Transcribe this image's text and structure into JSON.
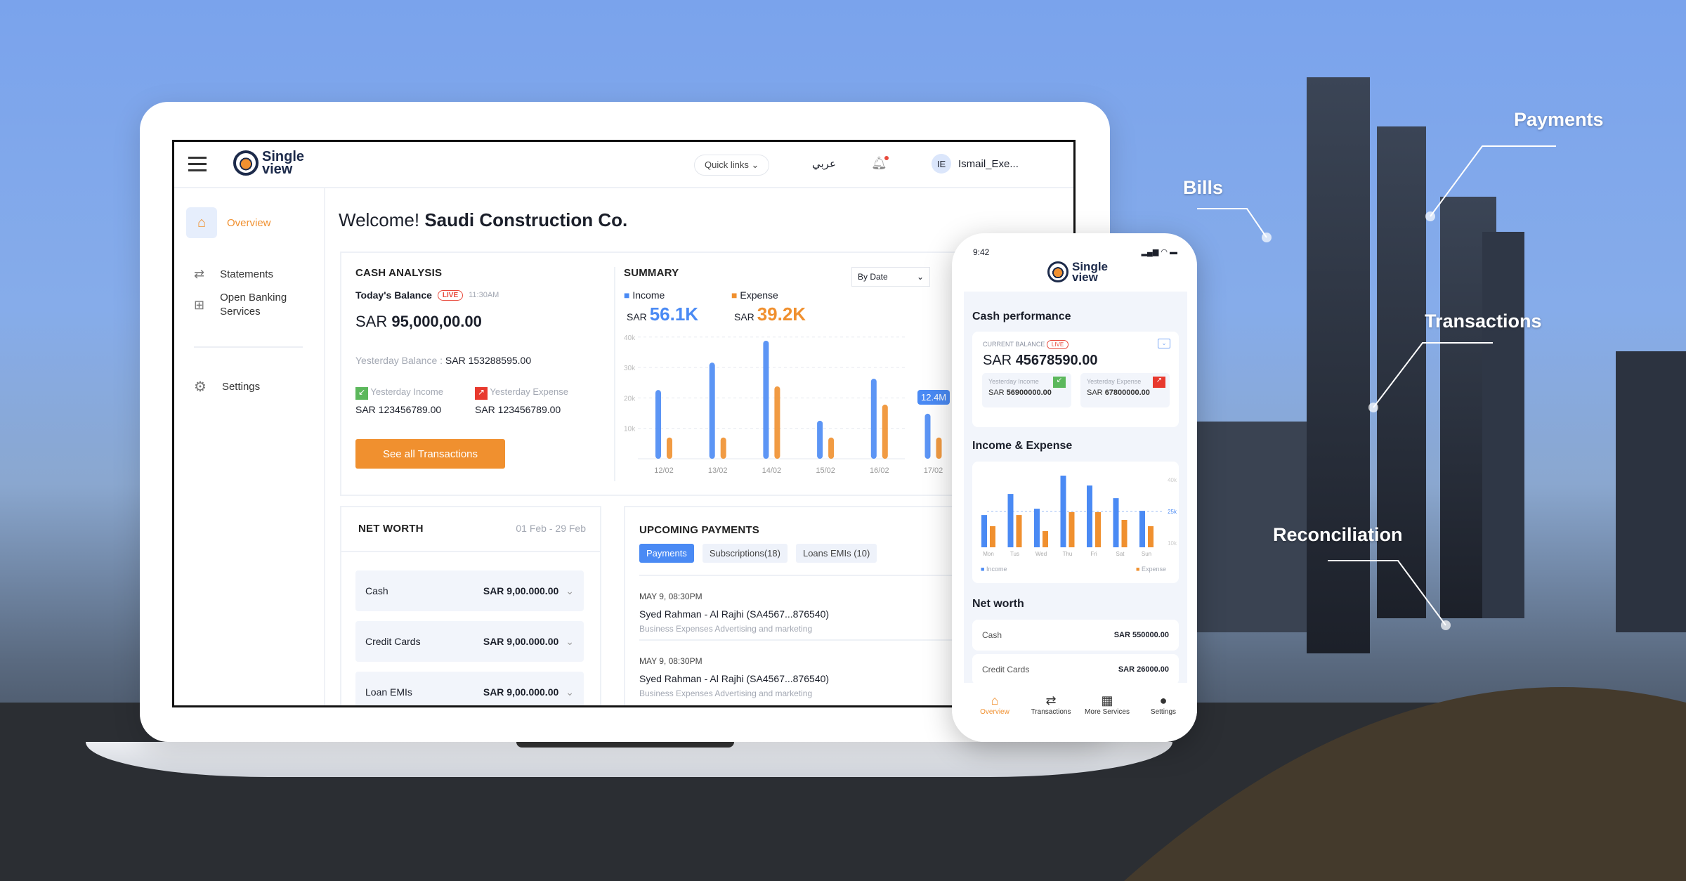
{
  "callouts": {
    "payments": "Payments",
    "bills": "Bills",
    "transactions": "Transactions",
    "reconciliation": "Reconciliation"
  },
  "colors": {
    "income": "#4a8af4",
    "expense": "#f0902f",
    "accent": "#f0902f",
    "live": "#e84a3c"
  },
  "desktop": {
    "header": {
      "logo_line1": "Single",
      "logo_line2": "view",
      "quick_links": "Quick links",
      "language": "عربي",
      "user_initials": "IE",
      "user_name": "Ismail_Exe..."
    },
    "sidebar": {
      "items": [
        {
          "label": "Overview",
          "icon": "home-icon",
          "active": true
        },
        {
          "label": "Statements",
          "icon": "transfer-icon"
        },
        {
          "label": "Open Banking Services",
          "icon": "grid-icon"
        },
        {
          "label": "Settings",
          "icon": "gear-icon"
        }
      ]
    },
    "welcome": {
      "prefix": "Welcome!",
      "company": "Saudi Construction Co."
    },
    "cash_analysis": {
      "title": "CASH ANALYSIS",
      "todays_balance_label": "Today's Balance",
      "live": "LIVE",
      "time": "11:30AM",
      "currency": "SAR",
      "balance": "95,000,00.00",
      "yesterday_balance_label": "Yesterday Balance :",
      "yesterday_balance": "SAR 153288595.00",
      "yesterday_income_label": "Yesterday Income",
      "yesterday_income": "SAR 123456789.00",
      "yesterday_expense_label": "Yesterday Expense",
      "yesterday_expense": "SAR 123456789.00",
      "cta": "See all Transactions"
    },
    "summary": {
      "title": "SUMMARY",
      "filter": "By Date",
      "income_label": "Income",
      "expense_label": "Expense",
      "currency": "SAR",
      "income_value": "56.1K",
      "expense_value": "39.2K",
      "tooltip": "12.4M"
    },
    "net_worth": {
      "title": "NET WORTH",
      "range": "01 Feb - 29 Feb",
      "rows": [
        {
          "label": "Cash",
          "value": "SAR 9,00.000.00"
        },
        {
          "label": "Credit Cards",
          "value": "SAR 9,00.000.00"
        },
        {
          "label": "Loan EMIs",
          "value": "SAR 9,00.000.00"
        }
      ]
    },
    "upcoming": {
      "title": "UPCOMING PAYMENTS",
      "tabs": [
        "Payments",
        "Subscriptions(18)",
        "Loans EMIs (10)"
      ],
      "items": [
        {
          "date": "MAY 9, 08:30PM",
          "name": "Syed Rahman - Al Rajhi (SA4567...876540)",
          "desc": "Business Expenses Advertising and marketing"
        },
        {
          "date": "MAY 9, 08:30PM",
          "name": "Syed Rahman - Al Rajhi (SA4567...876540)",
          "desc": "Business Expenses Advertising and marketing"
        }
      ]
    }
  },
  "phone": {
    "time": "9:42",
    "logo_line1": "Single",
    "logo_line2": "view",
    "cash_performance": {
      "title": "Cash performance",
      "label": "CURRENT BALANCE",
      "live": "LIVE",
      "currency": "SAR",
      "balance": "45678590.00",
      "yesterday_income_label": "Yesterday Income",
      "yesterday_income_currency": "SAR",
      "yesterday_income": "56900000.00",
      "yesterday_expense_label": "Yesterday Expense",
      "yesterday_expense_currency": "SAR",
      "yesterday_expense": "67800000.00"
    },
    "income_expense": {
      "title": "Income & Expense",
      "legend_income": "Income",
      "legend_expense": "Expense"
    },
    "net_worth": {
      "title": "Net worth",
      "rows": [
        {
          "label": "Cash",
          "value": "SAR 550000.00"
        },
        {
          "label": "Credit Cards",
          "value": "SAR 26000.00"
        }
      ]
    },
    "nav": [
      {
        "label": "Overview",
        "icon": "home-icon",
        "active": true
      },
      {
        "label": "Transactions",
        "icon": "transfer-icon"
      },
      {
        "label": "More Services",
        "icon": "grid-icon"
      },
      {
        "label": "Settings",
        "icon": "user-icon"
      }
    ]
  },
  "chart_data": [
    {
      "type": "bar",
      "categories": [
        "12/02",
        "13/02",
        "14/02",
        "15/02",
        "16/02",
        "17/02"
      ],
      "yticks": [
        "10k",
        "20k",
        "30k",
        "40k"
      ],
      "ylim": [
        0,
        40
      ],
      "grid": true,
      "series": [
        {
          "name": "Income",
          "values": [
            22.6,
            31.6,
            38.8,
            12.5,
            26.3,
            14.8
          ]
        },
        {
          "name": "Expense",
          "values": [
            7,
            7,
            23.8,
            7,
            17.8,
            7
          ]
        }
      ]
    },
    {
      "type": "bar",
      "categories": [
        "Mon",
        "Tus",
        "Wed",
        "Thu",
        "Fri",
        "Sat",
        "Sun"
      ],
      "yticks": [
        "10k",
        "25k",
        "40k"
      ],
      "ylim": [
        8,
        42
      ],
      "reference_line": 25,
      "series": [
        {
          "name": "Income",
          "values": [
            23.3,
            33.3,
            26.3,
            42,
            37.3,
            31.3,
            25.3
          ]
        },
        {
          "name": "Expense",
          "values": [
            18,
            23.3,
            15.7,
            24.7,
            24.7,
            21,
            18
          ]
        }
      ]
    }
  ]
}
